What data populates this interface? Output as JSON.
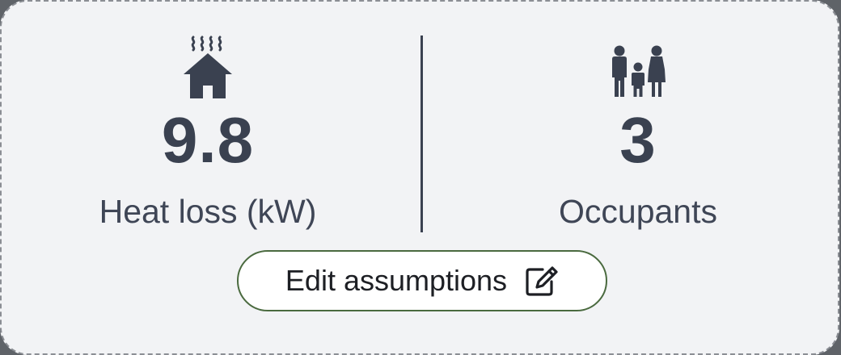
{
  "stats": {
    "heat_loss": {
      "icon": "house-heat-icon",
      "value": "9.8",
      "label": "Heat loss (kW)"
    },
    "occupants": {
      "icon": "family-icon",
      "value": "3",
      "label": "Occupants"
    }
  },
  "edit_button": {
    "label": "Edit assumptions",
    "icon": "edit-icon"
  },
  "colors": {
    "card_background": "#f2f3f5",
    "text": "#3a4150",
    "button_border": "#4a6a3f"
  }
}
